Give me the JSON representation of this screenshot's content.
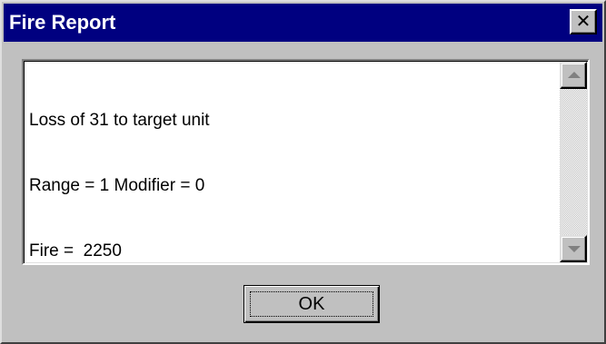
{
  "window": {
    "title": "Fire Report",
    "close_glyph": "✕",
    "colors": {
      "titlebar": "#000080",
      "face": "#c0c0c0"
    }
  },
  "report": {
    "lines": [
      "Loss of 31 to target unit",
      "Range = 1 Modifier = 0",
      "Fire =  2250"
    ]
  },
  "scrollbar": {
    "up_icon": "arrow-up-icon",
    "down_icon": "arrow-down-icon"
  },
  "buttons": {
    "ok_label": "OK"
  }
}
